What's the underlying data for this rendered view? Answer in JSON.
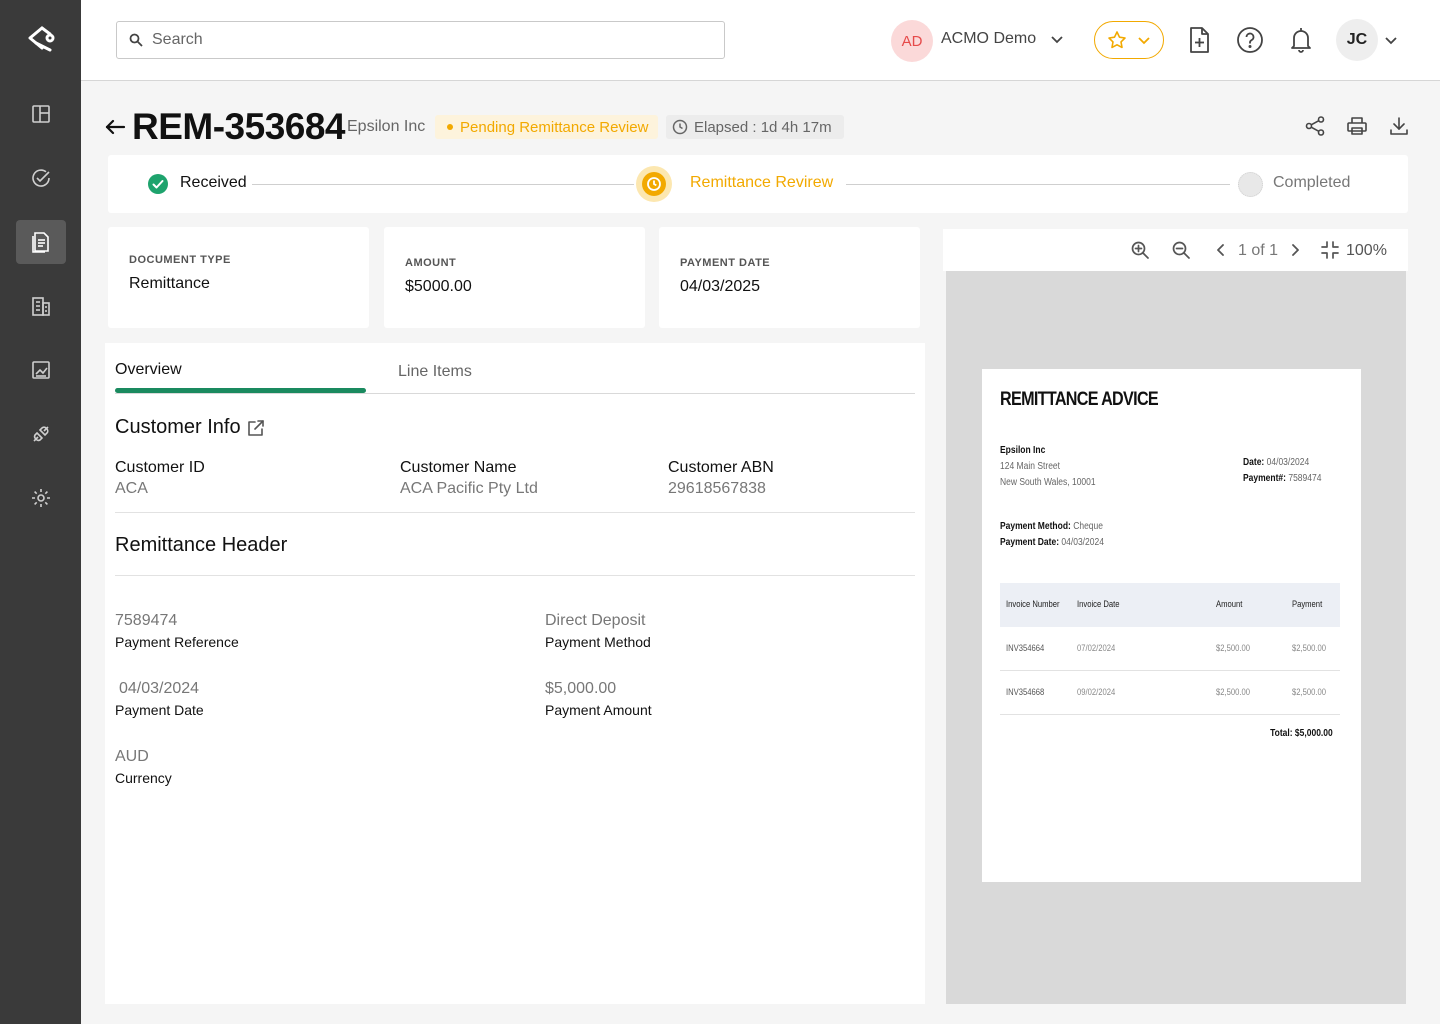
{
  "search": {
    "placeholder": "Search"
  },
  "org": {
    "initials": "AD",
    "name": "ACMO Demo"
  },
  "user": {
    "initials": "JC"
  },
  "colors": {
    "accent": "#f2a900",
    "success": "#1a8a5f",
    "sidebar": "#3a3a3a"
  },
  "sidebar": {
    "items": [
      {
        "icon": "dashboard-icon"
      },
      {
        "icon": "tasks-check-icon"
      },
      {
        "icon": "documents-icon",
        "active": true
      },
      {
        "icon": "building-icon"
      },
      {
        "icon": "analytics-icon"
      },
      {
        "icon": "integrations-plug-icon"
      },
      {
        "icon": "settings-gear-icon"
      }
    ]
  },
  "header": {
    "doc_id": "REM-353684",
    "company": "Epsilon Inc",
    "status": "Pending Remittance Review",
    "elapsed": "Elapsed : 1d 4h 17m"
  },
  "stepper": {
    "steps": [
      {
        "label": "Received",
        "state": "done"
      },
      {
        "label": "Remittance Revirew",
        "state": "current"
      },
      {
        "label": "Completed",
        "state": "pending"
      }
    ]
  },
  "summary": {
    "doc_type_label": "DOCUMENT TYPE",
    "doc_type_value": "Remittance",
    "amount_label": "AMOUNT",
    "amount_value": "$5000.00",
    "payment_date_label": "PAYMENT DATE",
    "payment_date_value": "04/03/2025"
  },
  "tabs": [
    {
      "label": "Overview",
      "active": true
    },
    {
      "label": "Line Items",
      "active": false
    }
  ],
  "customer_info": {
    "title": "Customer Info",
    "fields": [
      {
        "label": "Customer ID",
        "value": "ACA"
      },
      {
        "label": "Customer Name",
        "value": "ACA Pacific Pty Ltd"
      },
      {
        "label": "Customer ABN",
        "value": "29618567838"
      }
    ]
  },
  "remittance_header": {
    "title": "Remittance Header",
    "fields": [
      {
        "value": "7589474",
        "label": "Payment Reference"
      },
      {
        "value": "Direct Deposit",
        "label": "Payment Method"
      },
      {
        "value": "04/03/2024",
        "label": "Payment Date"
      },
      {
        "value": "$5,000.00",
        "label": "Payment Amount"
      },
      {
        "value": "AUD",
        "label": "Currency"
      }
    ]
  },
  "viewer": {
    "page_indicator": "1 of 1",
    "zoom": "100%"
  },
  "document": {
    "title": "REMITTANCE ADVICE",
    "company": "Epsilon Inc",
    "address1": "124 Main Street",
    "address2": "New South Wales, 10001",
    "date_label": "Date:",
    "date_value": "04/03/2024",
    "payment_no_label": "Payment#:",
    "payment_no_value": "7589474",
    "method_label": "Payment Method:",
    "method_value": "Cheque",
    "pay_date_label": "Payment Date:",
    "pay_date_value": "04/03/2024",
    "columns": [
      "Invoice Number",
      "Invoice Date",
      "Amount",
      "Payment"
    ],
    "rows": [
      [
        "INV354664",
        "07/02/2024",
        "$2,500.00",
        "$2,500.00"
      ],
      [
        "INV354668",
        "09/02/2024",
        "$2,500.00",
        "$2,500.00"
      ]
    ],
    "total": "Total: $5,000.00"
  }
}
